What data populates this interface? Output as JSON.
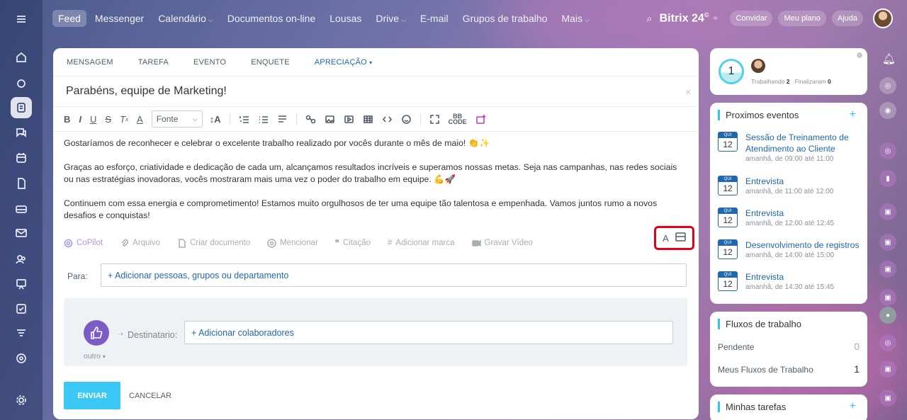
{
  "topbar": {
    "nav": [
      {
        "label": "Feed",
        "active": true,
        "chev": false
      },
      {
        "label": "Messenger",
        "chev": false
      },
      {
        "label": "Calendário",
        "chev": true
      },
      {
        "label": "Documentos on-line",
        "chev": false
      },
      {
        "label": "Lousas",
        "chev": false
      },
      {
        "label": "Drive",
        "chev": true
      },
      {
        "label": "E-mail",
        "chev": false
      },
      {
        "label": "Grupos de trabalho",
        "chev": false
      },
      {
        "label": "Mais",
        "chev": true
      }
    ],
    "brand": "Bitrix 24",
    "brand_mark": "©",
    "invite_label": "Convidar",
    "plan_label": "Meu plano",
    "help_label": "Ajuda"
  },
  "composer": {
    "tabs": [
      "MENSAGEM",
      "TAREFA",
      "EVENTO",
      "ENQUETE",
      "APRECIAÇÃO"
    ],
    "active_tab": "APRECIAÇÃO",
    "title": "Parabéns, equipe de Marketing!",
    "font_select": "Fonte",
    "body": [
      "Gostaríamos de reconhecer e celebrar o excelente trabalho realizado por vocês durante o mês de maio! 👏✨",
      "Graças ao esforço, criatividade e dedicação de cada um, alcançamos resultados incríveis e superamos nossas metas. Seja nas campanhas, nas redes sociais ou nas estratégias inovadoras, vocês mostraram mais uma vez o poder do trabalho em equipe. 💪🚀",
      "Continuem com essa energia e comprometimento! Estamos muito orgulhosos de ter uma equipe tão talentosa e empenhada. Vamos juntos rumo a novos desafios e conquistas!"
    ],
    "actions": [
      "CoPilot",
      "Arquivo",
      "Criar documento",
      "Mencionar",
      "Citação",
      "Adicionar marca",
      "Gravar Vídeo"
    ],
    "to_label": "Para:",
    "to_add": "+ Adicionar pessoas, grupos ou departamento",
    "badge_label": "outro",
    "recipient_label": "Destinatario:",
    "recipient_add": "+ Adicionar colaboradores",
    "send_label": "ENVIAR",
    "cancel_label": "CANCELAR"
  },
  "status_widget": {
    "count": "1",
    "working_label": "Trabalhando",
    "working_count": "2",
    "finished_label": "Finalizaram",
    "finished_count": "0"
  },
  "events_panel": {
    "title": "Proximos eventos",
    "events": [
      {
        "weekday": "QUI",
        "day": "12",
        "name": "Sessão de Treinamento de Atendimento ao Cliente",
        "time": "amanhã, de 09:00 até 11:00"
      },
      {
        "weekday": "QUI",
        "day": "12",
        "name": "Entrevista",
        "time": "amanhã, de 11:00 até 12:00"
      },
      {
        "weekday": "QUI",
        "day": "12",
        "name": "Entrevista",
        "time": "amanhã, de 12:00 até 12:45"
      },
      {
        "weekday": "QUI",
        "day": "12",
        "name": "Desenvolvimento de registros",
        "time": "amanhã, de 14:00 até 15:00"
      },
      {
        "weekday": "QUI",
        "day": "12",
        "name": "Entrevista",
        "time": "amanhã, de 14:30 até 15:45"
      }
    ]
  },
  "workflows_panel": {
    "title": "Fluxos de trabalho",
    "rows": [
      {
        "label": "Pendente",
        "value": "0"
      },
      {
        "label": "Meus Fluxos de Trabalho",
        "value": "1"
      }
    ]
  },
  "tasks_panel": {
    "title": "Minhas tarefas"
  }
}
